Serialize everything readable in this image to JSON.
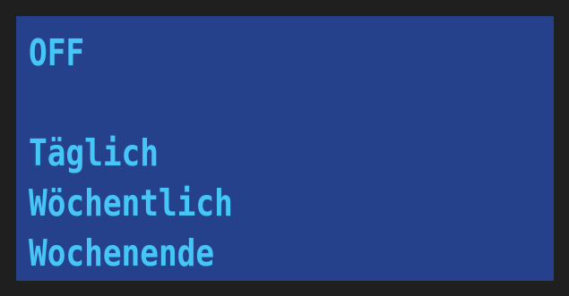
{
  "display": {
    "status": "OFF",
    "options": [
      "Täglich",
      "Wöchentlich",
      "Wochenende"
    ]
  },
  "colors": {
    "bezel": "#1f1f1f",
    "panel_background": "#26418c",
    "text": "#45c6f6"
  }
}
